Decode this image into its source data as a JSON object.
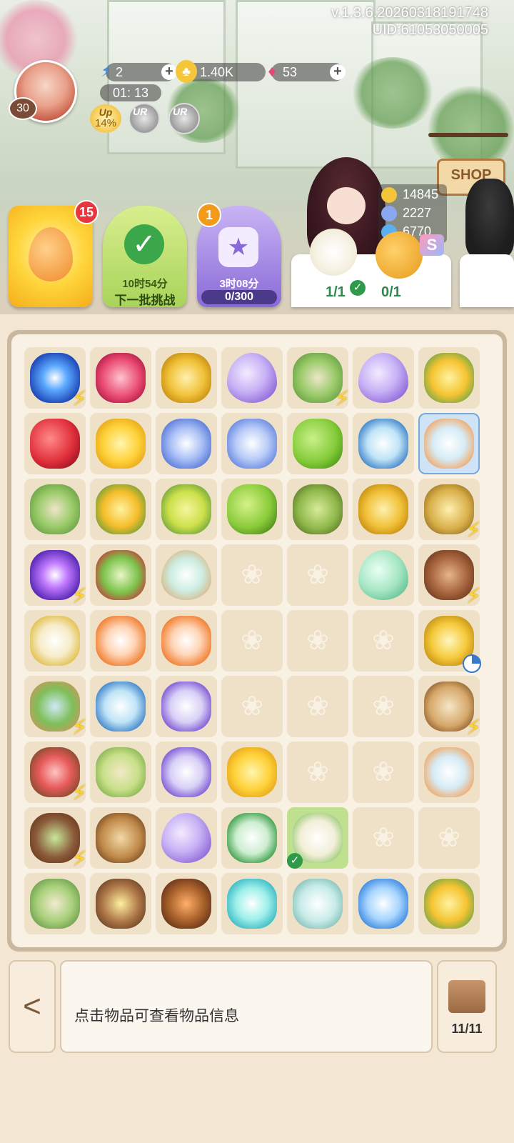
{
  "header": {
    "version": "v.1.3.6.20260318191748",
    "uid": "UID:61053050005",
    "level": "30",
    "energy": "2",
    "coins": "1.40K",
    "gems": "53",
    "timer": "01: 13",
    "up_label": "Up",
    "up_percent": "14%",
    "ur_label": "UR"
  },
  "shop": {
    "label": "SHOP"
  },
  "stats": {
    "coins": "14845",
    "stars": "2227",
    "butterflies": "6770"
  },
  "cards": {
    "drop_badge": "15",
    "daily_time": "10时54分",
    "daily_label": "下一批挑战",
    "bottle_badge": "1",
    "bottle_time": "3时08分",
    "bottle_progress": "0/300",
    "bottle_progress_value": 0
  },
  "orders": [
    {
      "count": "1/1",
      "done": true
    },
    {
      "count": "0/1",
      "done": false
    }
  ],
  "board": {
    "rows": [
      [
        {
          "icon": "galaxy",
          "bolt": true
        },
        {
          "icon": "ruby-gems"
        },
        {
          "icon": "gold-coins"
        },
        {
          "icon": "purple-drop"
        },
        {
          "icon": "garden-arch",
          "bolt": true
        },
        {
          "icon": "purple-drop"
        },
        {
          "icon": "yellow-orchid"
        }
      ],
      [
        {
          "icon": "pomegranate"
        },
        {
          "icon": "yellow-flowers"
        },
        {
          "icon": "crystal-bolts"
        },
        {
          "icon": "crystal-bolt"
        },
        {
          "icon": "green-lime"
        },
        {
          "icon": "glass-dome-blue"
        },
        {
          "icon": "cat-teacup",
          "selected": true
        }
      ],
      [
        {
          "icon": "garden-arch"
        },
        {
          "icon": "pineapple-gold"
        },
        {
          "icon": "pineapple-green"
        },
        {
          "icon": "green-pepper"
        },
        {
          "icon": "green-grapes"
        },
        {
          "icon": "gold-coins"
        },
        {
          "icon": "picnic-basket",
          "bolt": true
        }
      ],
      [
        {
          "icon": "galaxy-purple",
          "bolt": true
        },
        {
          "icon": "gift-box"
        },
        {
          "icon": "drops-vase"
        },
        {
          "icon": "empty"
        },
        {
          "icon": "empty"
        },
        {
          "icon": "green-drop"
        },
        {
          "icon": "teapot",
          "bolt": true
        }
      ],
      [
        {
          "icon": "glass-dome-vanilla"
        },
        {
          "icon": "clownfish"
        },
        {
          "icon": "clownfish"
        },
        {
          "icon": "empty"
        },
        {
          "icon": "empty"
        },
        {
          "icon": "empty"
        },
        {
          "icon": "perfume-bottle",
          "pie": true
        }
      ],
      [
        {
          "icon": "garden-pond",
          "bolt": true
        },
        {
          "icon": "glass-dome-blue"
        },
        {
          "icon": "glass-dome-purple"
        },
        {
          "icon": "empty"
        },
        {
          "icon": "empty"
        },
        {
          "icon": "empty"
        },
        {
          "icon": "shelf",
          "bolt": true
        }
      ],
      [
        {
          "icon": "flower-bed",
          "bolt": true
        },
        {
          "icon": "green-tile"
        },
        {
          "icon": "glass-dome-purple"
        },
        {
          "icon": "yellow-flowers"
        },
        {
          "icon": "empty"
        },
        {
          "icon": "empty"
        },
        {
          "icon": "cat-teacup"
        }
      ],
      [
        {
          "icon": "seed-bed",
          "bolt": true
        },
        {
          "icon": "cookie-tray"
        },
        {
          "icon": "purple-drop"
        },
        {
          "icon": "glass-dome-green"
        },
        {
          "icon": "water-lily",
          "check": true
        },
        {
          "icon": "empty"
        },
        {
          "icon": "empty"
        }
      ],
      [
        {
          "icon": "garden-pergola"
        },
        {
          "icon": "stove"
        },
        {
          "icon": "stove-fire"
        },
        {
          "icon": "cyan-shards"
        },
        {
          "icon": "glass-vase"
        },
        {
          "icon": "blue-crystal"
        },
        {
          "icon": "yellow-orchid"
        }
      ]
    ]
  },
  "footer": {
    "back_label": "<",
    "info_text": "点击物品可查看物品信息",
    "box_count": "11/11"
  }
}
